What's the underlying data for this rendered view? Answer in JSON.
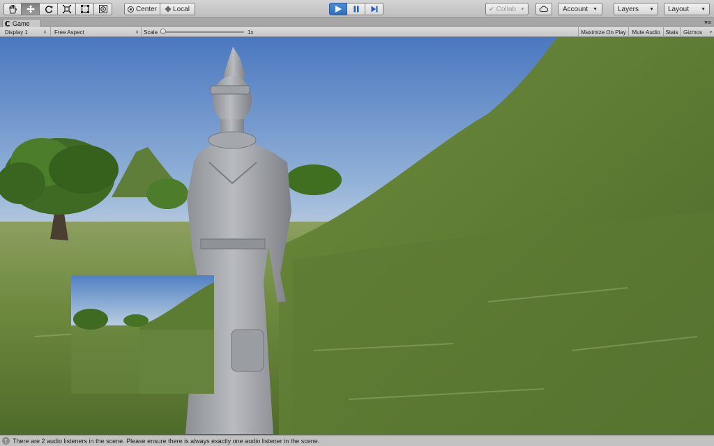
{
  "toolbar": {
    "tools": [
      {
        "name": "hand-tool"
      },
      {
        "name": "move-tool"
      },
      {
        "name": "rotate-tool"
      },
      {
        "name": "scale-tool"
      },
      {
        "name": "rect-tool"
      },
      {
        "name": "transform-tool"
      }
    ],
    "active_tool": "move-tool",
    "pivot_label": "Center",
    "space_label": "Local",
    "collab_label": "Collab",
    "account_label": "Account",
    "layers_label": "Layers",
    "layout_label": "Layout",
    "playing": true
  },
  "window": {
    "tab_label": "Game"
  },
  "game_toolbar": {
    "display": "Display 1",
    "aspect": "Free Aspect",
    "scale_label": "Scale",
    "scale_value": "1x",
    "scale_slider_fraction": 0.0,
    "maximize_label": "Maximize On Play",
    "mute_label": "Mute Audio",
    "stats_label": "Stats",
    "gizmos_label": "Gizmos"
  },
  "status": {
    "message": "There are 2 audio listeners in the scene. Please ensure there is always exactly one audio listener in the scene."
  },
  "colors": {
    "play_blue": "#2f6fbd",
    "sky_top": "#4f7bc0",
    "sky_bottom": "#b6c9dc",
    "grass": "#6c8c3c"
  }
}
